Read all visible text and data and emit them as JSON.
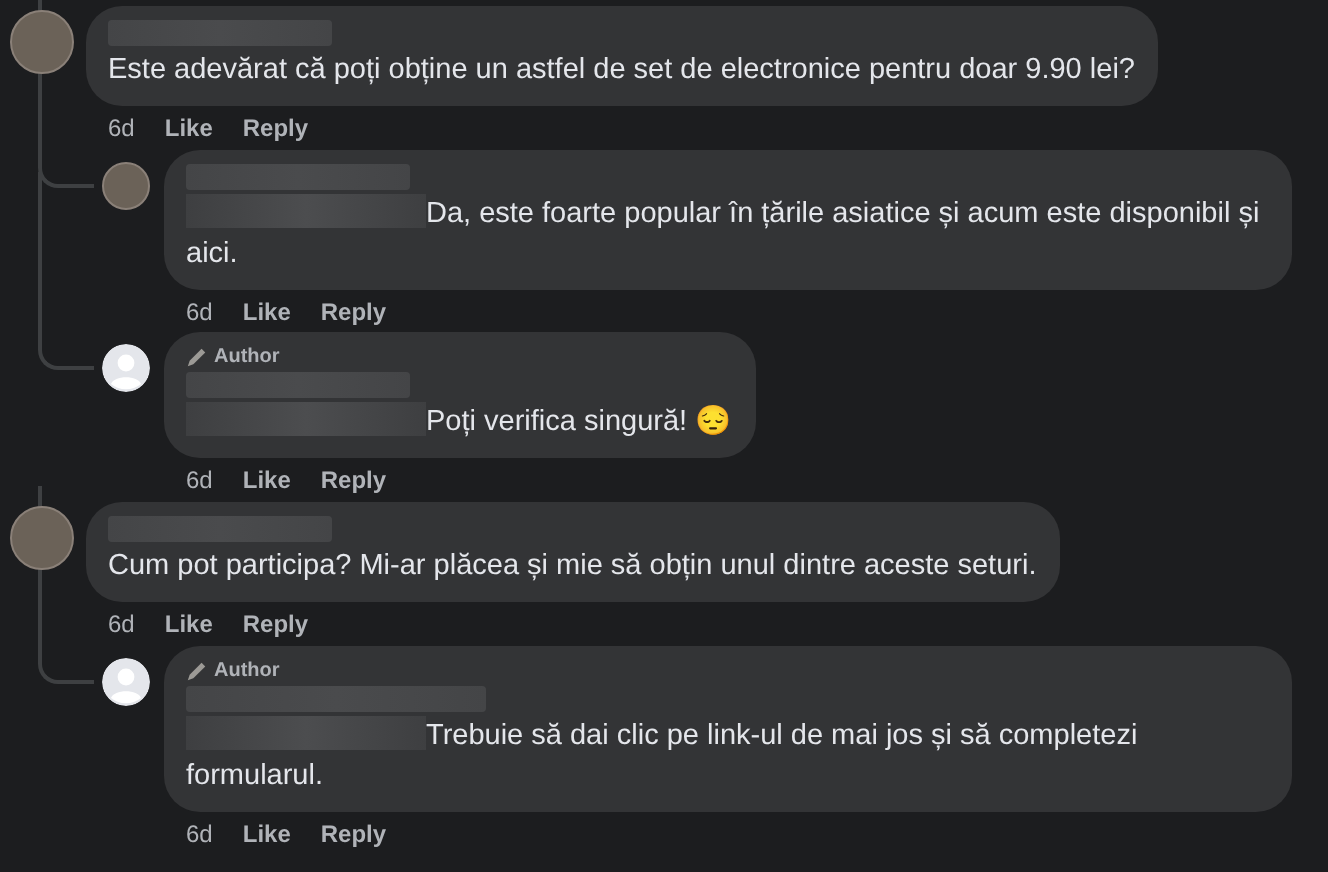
{
  "comments": [
    {
      "avatar": {
        "kind": "photo"
      },
      "mention": false,
      "text": "Este adevărat că poți obține un astfel de set de electronice pentru doar 9.90 lei?",
      "time": "6d",
      "actions": [
        "Like",
        "Reply"
      ],
      "replies": [
        {
          "avatar": {
            "kind": "photo"
          },
          "mention": true,
          "text": "Da, este foarte popular în țările asiatice și acum este disponibil și aici.",
          "time": "6d",
          "actions": [
            "Like",
            "Reply"
          ]
        },
        {
          "avatar": {
            "kind": "default"
          },
          "badge": "Author",
          "mention": true,
          "text": "Poți verifica singură! 😔",
          "time": "6d",
          "actions": [
            "Like",
            "Reply"
          ]
        }
      ]
    },
    {
      "avatar": {
        "kind": "photo"
      },
      "mention": false,
      "text": "Cum pot participa? Mi-ar plăcea și mie să obțin unul dintre aceste seturi.",
      "time": "6d",
      "actions": [
        "Like",
        "Reply"
      ],
      "replies": [
        {
          "avatar": {
            "kind": "default"
          },
          "badge": "Author",
          "mention": true,
          "text": "Trebuie să dai clic pe link-ul de mai jos și să completezi formularul.",
          "time": "6d",
          "actions": [
            "Like",
            "Reply"
          ]
        }
      ]
    }
  ]
}
